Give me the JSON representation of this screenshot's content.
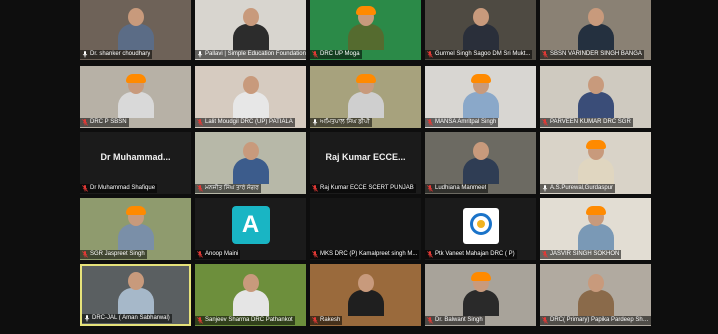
{
  "colors": {
    "background": "#0e0e0e",
    "tile": "#1b1b1b",
    "muted_mic": "#e53935",
    "active_speaker_border": "#e6e27a",
    "avatar": "#19b5c4"
  },
  "participants": [
    {
      "label": "Dr. shanker choudhary",
      "muted": false
    },
    {
      "label": "Pallavi | Simple Education Foundation",
      "muted": false
    },
    {
      "label": "DRC UP Moga",
      "muted": true
    },
    {
      "label": "Gurmel Singh Sagoo DM Sri Mukt...",
      "muted": true
    },
    {
      "label": "SBSN VARINDER SINGH BANGA",
      "muted": true
    },
    {
      "label": "DRC P SBSN",
      "muted": true
    },
    {
      "label": "Lalit Moudgil DRC (UP) PATIALA",
      "muted": true
    },
    {
      "label": "ਅਮਿਤਪਾਲ ਸਿੰਘ ਡੀਪੀ",
      "muted": false
    },
    {
      "label": "MANSA Amritpal Singh",
      "muted": true
    },
    {
      "label": "PARVEEN KUMAR DRC SGR",
      "muted": true
    },
    {
      "label": "Dr Muhammad Shafique",
      "display_name": "Dr Muhammad...",
      "muted": true
    },
    {
      "label": "ਮਨਜੀਤ ਸਿੰਘ ਤਾਰੇ ਸੰਗਰ",
      "muted": true
    },
    {
      "label": "Raj Kumar ECCE SCERT PUNJAB",
      "display_name": "Raj Kumar ECCE...",
      "muted": true
    },
    {
      "label": "Ludhiana Manmeet",
      "muted": true
    },
    {
      "label": "A.S.Purewal,Gurdaspur",
      "muted": false
    },
    {
      "label": "SGR Jaspreet Singh",
      "muted": true
    },
    {
      "label": "Anoop Maini",
      "avatar_letter": "A",
      "muted": true
    },
    {
      "label": "MKS DRC (P) Kamalpreet singh M...",
      "muted": true
    },
    {
      "label": "Ptk Vaneet Mahajan DRC ( P)",
      "muted": true
    },
    {
      "label": "JASVIR SINGH SOKHON",
      "muted": true
    },
    {
      "label": "DRC-JAL ( Aman Sabharwal)",
      "muted": false,
      "active": true
    },
    {
      "label": "Sanjeev Sharma DRC Pathankot",
      "muted": true
    },
    {
      "label": "Rakesh",
      "muted": true
    },
    {
      "label": "Dr. Balwant Singh",
      "muted": true
    },
    {
      "label": "DRC( Primary) Papika Pardeep Sha...",
      "muted": true
    }
  ]
}
